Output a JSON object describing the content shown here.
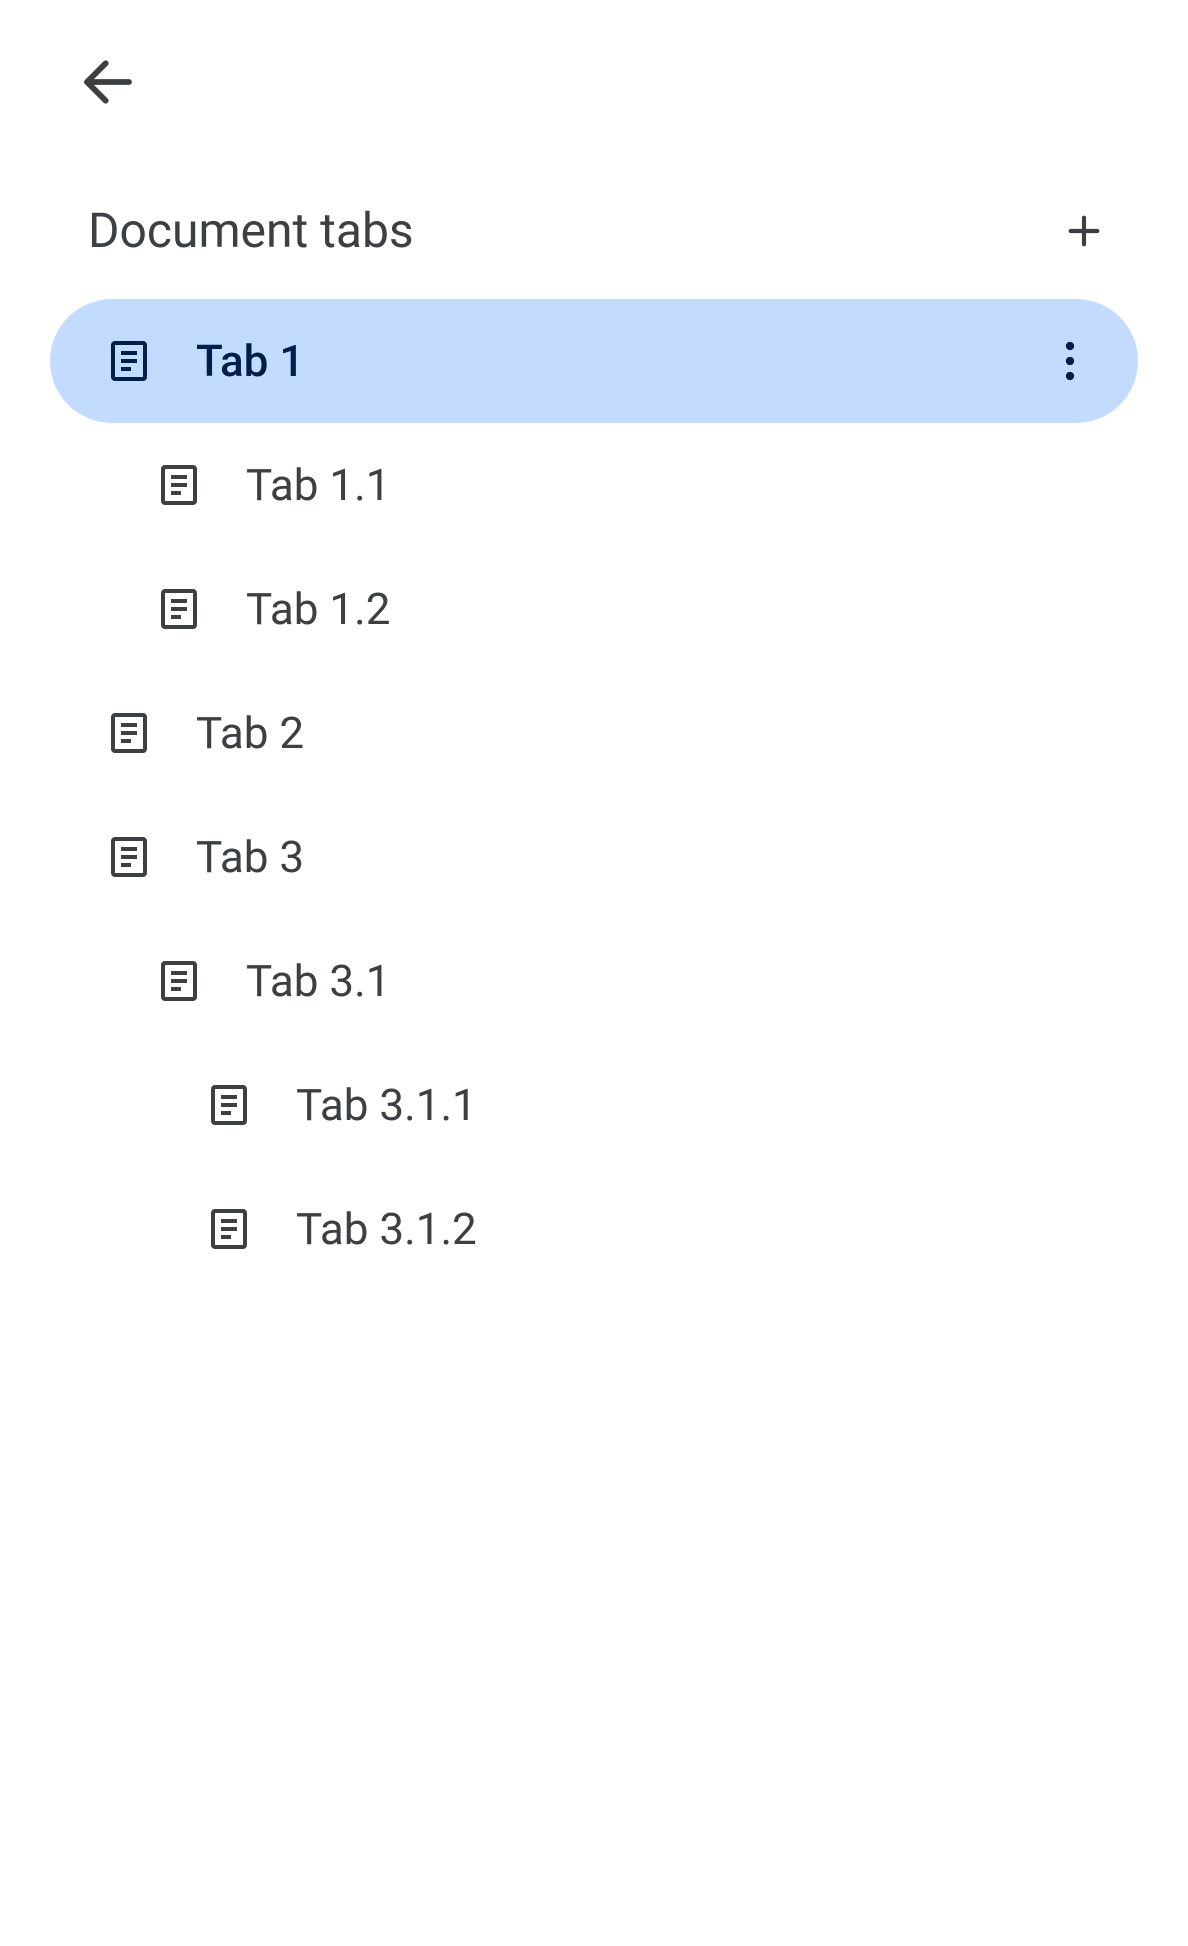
{
  "header": {
    "title": "Document tabs"
  },
  "tabs": [
    {
      "label": "Tab 1",
      "level": 0,
      "selected": true
    },
    {
      "label": "Tab 1.1",
      "level": 1,
      "selected": false
    },
    {
      "label": "Tab 1.2",
      "level": 1,
      "selected": false
    },
    {
      "label": "Tab 2",
      "level": 0,
      "selected": false
    },
    {
      "label": "Tab 3",
      "level": 0,
      "selected": false
    },
    {
      "label": "Tab 3.1",
      "level": 1,
      "selected": false
    },
    {
      "label": "Tab 3.1.1",
      "level": 2,
      "selected": false
    },
    {
      "label": "Tab 3.1.2",
      "level": 2,
      "selected": false
    }
  ],
  "colors": {
    "selected_bg": "#c2dbff",
    "selected_text": "#041e49",
    "text": "#3c4043",
    "icon": "#3c4043"
  }
}
